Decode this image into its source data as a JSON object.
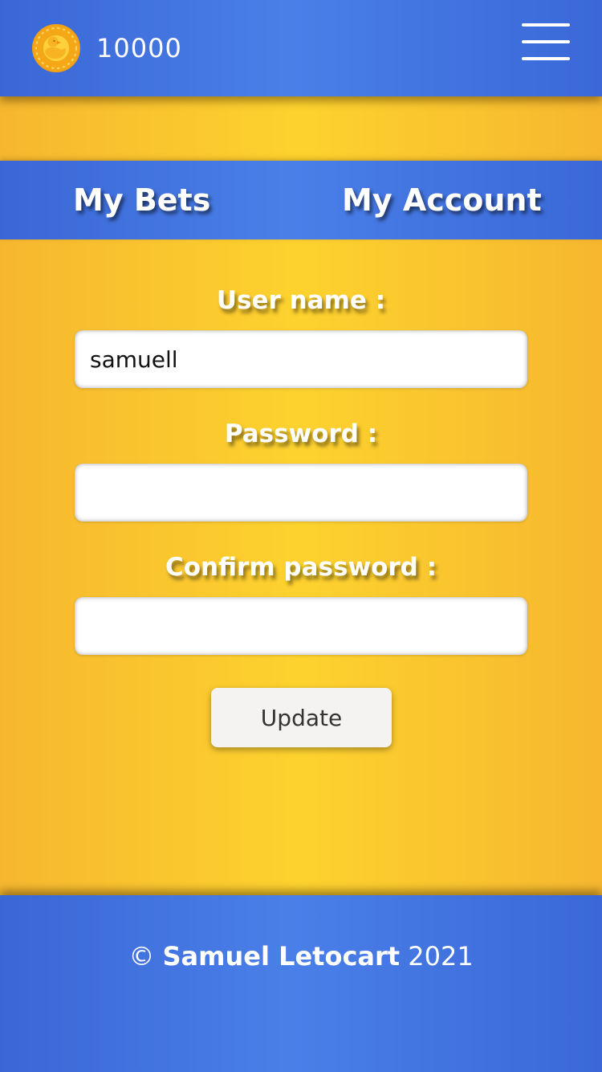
{
  "header": {
    "balance": "10000",
    "coin_icon": "duck-coin-icon",
    "menu_icon": "hamburger-menu-icon"
  },
  "tabs": [
    {
      "label": "My Bets"
    },
    {
      "label": "My Account"
    }
  ],
  "form": {
    "username_label": "User name :",
    "username_value": "samuell",
    "password_label": "Password :",
    "password_value": "",
    "confirm_label": "Confirm password :",
    "confirm_value": "",
    "update_label": "Update"
  },
  "footer": {
    "copyright_symbol": "©",
    "author": "Samuel Letocart",
    "year": "2021"
  },
  "colors": {
    "brand_blue": "#4a7fe8",
    "background_yellow": "#fdd22e",
    "coin_orange": "#f4a818"
  }
}
